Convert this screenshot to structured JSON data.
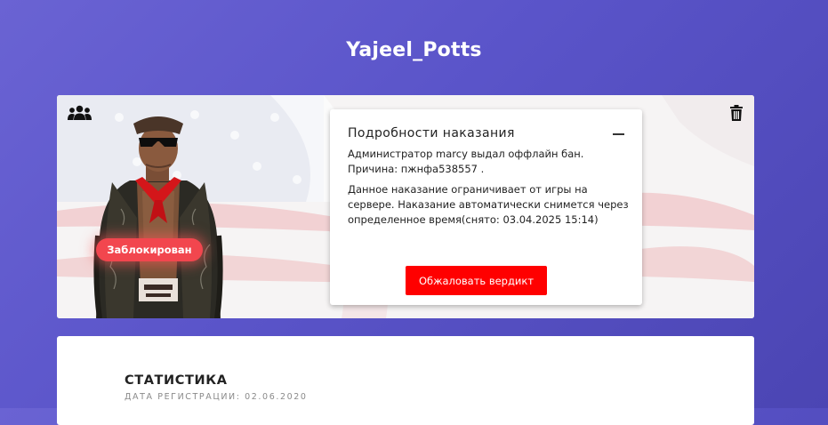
{
  "profile": {
    "username": "Yajeel_Potts",
    "status_badge": "Заблокирован",
    "icons": {
      "players": "players-group-icon",
      "delete": "trash-icon"
    }
  },
  "punishment": {
    "title": "Подробности наказания",
    "line1": "Администратор marcy выдал оффлайн бан.",
    "line2": "Причина: пжнфа538557 .",
    "description": "Данное наказание ограничивает от игры на сервере. Наказание автоматически снимется через определенное время(снято: 03.04.2025 15:14)",
    "appeal_button": "Обжаловать вердикт"
  },
  "stats": {
    "title": "СТАТИСТИКА",
    "registration": "ДАТА РЕГИСТРАЦИИ: 02.06.2020"
  },
  "colors": {
    "background_start": "#6a63d3",
    "background_end": "#4b45b3",
    "badge": "#f2464e",
    "appeal_button": "#ff0000"
  }
}
